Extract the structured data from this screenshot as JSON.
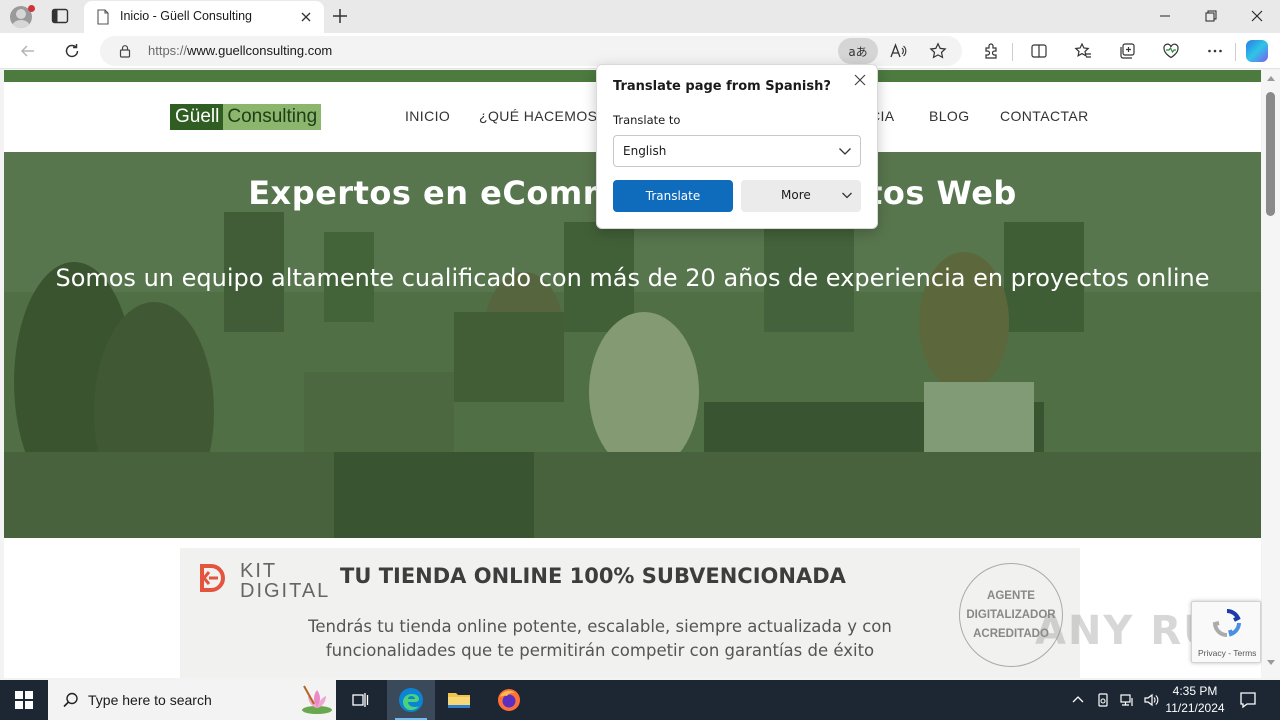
{
  "browser": {
    "tab_title": "Inicio - Güell Consulting",
    "url_prefix": "https://",
    "url_host": "www.guellconsulting.com",
    "translate_glyph": "aあ"
  },
  "site": {
    "logo_part1": "Güell",
    "logo_part2": "Consulting",
    "menu": [
      "INICIO",
      "¿QUÉ HACEMOS",
      "CIA",
      "BLOG",
      "CONTACTAR"
    ],
    "hero_title": "Expertos en eCommerce y Proyectos Web",
    "hero_subtitle": "Somos un equipo altamente cualificado con más de 20 años de experiencia en proyectos online",
    "kit_word1": "KIT",
    "kit_word2": "DIGITAL",
    "kit_title": "TU TIENDA ONLINE 100% SUBVENCIONADA",
    "kit_text": "Tendrás tu tienda online potente, escalable, siempre actualizada y con funcionalidades que te permitirán competir con garantías de éxito",
    "kit_badge": [
      "AGENTE",
      "DIGITALIZADOR",
      "ACREDITADO"
    ],
    "recaptcha_text": "Privacy - Terms",
    "watermark": "ANY RUN"
  },
  "translate_popup": {
    "title": "Translate page from Spanish?",
    "label": "Translate to",
    "selected_language": "English",
    "translate_button": "Translate",
    "more_button": "More"
  },
  "taskbar": {
    "search_placeholder": "Type here to search",
    "time": "4:35 PM",
    "date": "11/21/2024"
  },
  "colors": {
    "accent_blue": "#0f6cbd",
    "site_green": "#4c7a3f",
    "taskbar": "#1c2733"
  }
}
